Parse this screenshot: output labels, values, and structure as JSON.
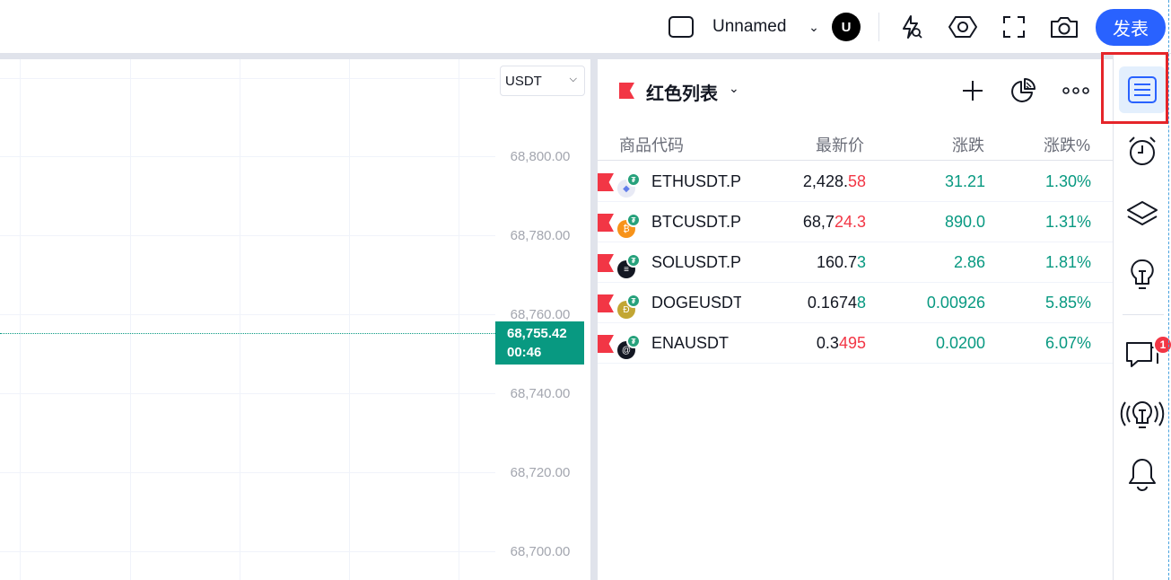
{
  "topbar": {
    "layout_name": "Unnamed",
    "avatar_letter": "U",
    "publish_label": "发表",
    "icons": [
      "layout-icon",
      "alert-flash-icon",
      "settings-hex-icon",
      "fullscreen-icon",
      "camera-icon"
    ]
  },
  "chart": {
    "currency_select": "USDT",
    "price_ticks": [
      "68,800.00",
      "68,780.00",
      "68,760.00",
      "68,740.00",
      "68,720.00",
      "68,700.00"
    ],
    "current_price": "68,755.42",
    "countdown": "00:46",
    "colors": {
      "up": "#089981",
      "grid": "#f0f3fa"
    }
  },
  "watchlist": {
    "title": "红色列表",
    "columns": {
      "symbol": "商品代码",
      "last": "最新价",
      "change": "涨跌",
      "change_pct": "涨跌%"
    },
    "rows": [
      {
        "symbol": "ETHUSDT.P",
        "price_main": "2,428.",
        "price_tail": "58",
        "tail_color": "down",
        "change": "31.21",
        "change_pct": "1.30%",
        "coin_icon": "eth-icon",
        "coin_color": "#e8eaf5"
      },
      {
        "symbol": "BTCUSDT.P",
        "price_main": "68,7",
        "price_tail": "24.3",
        "tail_color": "down",
        "change": "890.0",
        "change_pct": "1.31%",
        "coin_icon": "btc-icon",
        "coin_color": "#f7931a"
      },
      {
        "symbol": "SOLUSDT.P",
        "price_main": "160.7",
        "price_tail": "3",
        "tail_color": "up",
        "change": "2.86",
        "change_pct": "1.81%",
        "coin_icon": "sol-icon",
        "coin_color": "#131722"
      },
      {
        "symbol": "DOGEUSDT",
        "price_main": "0.1674",
        "price_tail": "8",
        "tail_color": "up",
        "change": "0.00926",
        "change_pct": "5.85%",
        "coin_icon": "doge-icon",
        "coin_color": "#c2a633"
      },
      {
        "symbol": "ENAUSDT",
        "price_main": "0.3",
        "price_tail": "495",
        "tail_color": "down",
        "change": "0.0200",
        "change_pct": "6.07%",
        "coin_icon": "ena-icon",
        "coin_color": "#131722"
      }
    ],
    "colors": {
      "up": "#089981",
      "down": "#f23645",
      "flag": "#f23645"
    }
  },
  "sidebar": {
    "items": [
      "watchlist-icon",
      "alarm-clock-icon",
      "layers-icon",
      "idea-bulb-icon",
      "chat-icon",
      "streams-icon",
      "bell-icon"
    ],
    "chat_badge": "1"
  }
}
